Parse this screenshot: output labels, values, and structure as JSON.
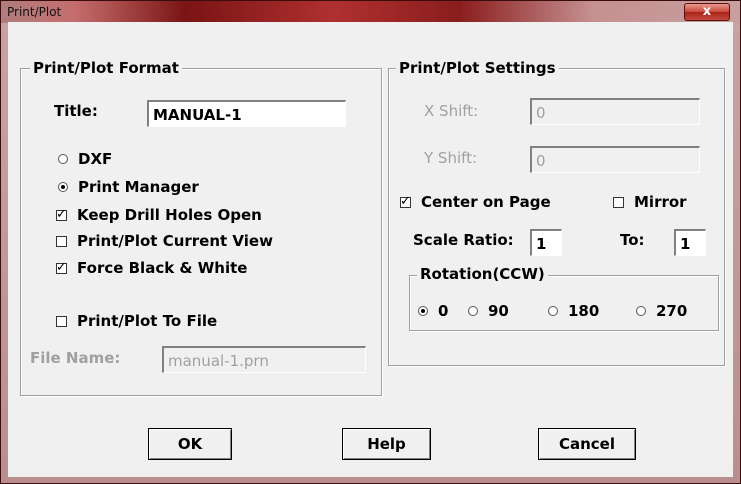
{
  "window": {
    "title": "Print/Plot",
    "close_symbol": "x"
  },
  "format": {
    "label": "Print/Plot Format",
    "title_label": "Title:",
    "title_value": "MANUAL-1",
    "dxf": {
      "label": "DXF",
      "selected": false
    },
    "print_manager": {
      "label": "Print Manager",
      "selected": true
    },
    "keep_drill": {
      "label": "Keep Drill Holes Open",
      "checked": true
    },
    "current_view": {
      "label": "Print/Plot Current View",
      "checked": false
    },
    "black_white": {
      "label": "Force Black & White",
      "checked": true
    },
    "to_file": {
      "label": "Print/Plot To File",
      "checked": false
    },
    "file_name_label": "File Name:",
    "file_name_value": "manual-1.prn"
  },
  "settings": {
    "label": "Print/Plot Settings",
    "x_shift_label": "X Shift:",
    "x_shift_value": "0",
    "y_shift_label": "Y Shift:",
    "y_shift_value": "0",
    "center": {
      "label": "Center on Page",
      "checked": true
    },
    "mirror": {
      "label": "Mirror",
      "checked": false
    },
    "scale_label": "Scale Ratio:",
    "scale_value": "1",
    "to_label": "To:",
    "to_value": "1",
    "rotation": {
      "label": "Rotation(CCW)",
      "options": [
        "0",
        "90",
        "180",
        "270"
      ],
      "selected": "0"
    }
  },
  "buttons": {
    "ok": "OK",
    "help": "Help",
    "cancel": "Cancel"
  }
}
